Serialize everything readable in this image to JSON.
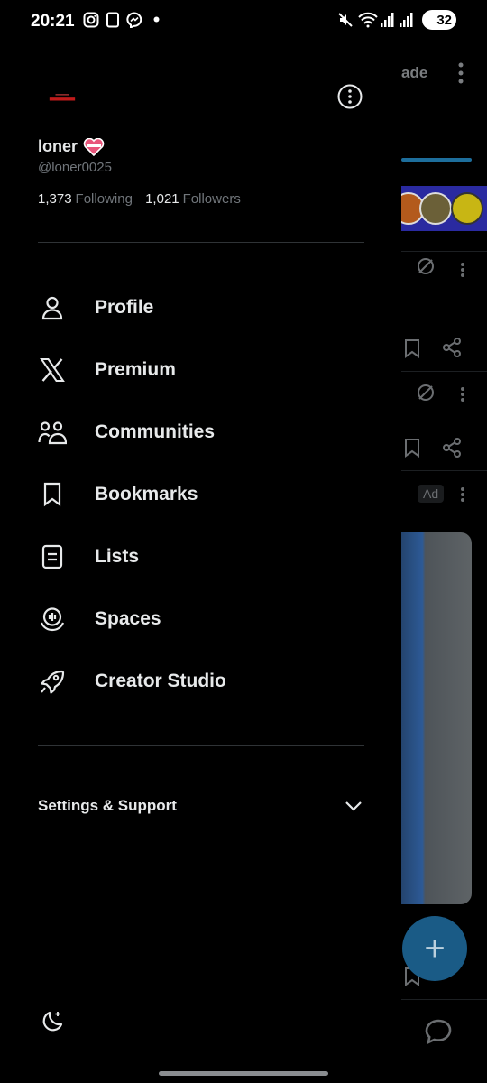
{
  "status_bar": {
    "time": "20:21",
    "battery": "32",
    "icons": [
      "instagram-icon",
      "tablet-icon",
      "messenger-icon",
      "dot-icon",
      "mute-icon",
      "wifi-icon",
      "signal-icon",
      "signal-icon",
      "battery-icon"
    ]
  },
  "background": {
    "header_partial": "ade",
    "ad_badge": "Ad"
  },
  "profile": {
    "name": "loner",
    "handle": "@loner0025",
    "following_count": "1,373",
    "following_label": "Following",
    "followers_count": "1,021",
    "followers_label": "Followers"
  },
  "menu": [
    {
      "label": "Profile",
      "icon": "person-icon"
    },
    {
      "label": "Premium",
      "icon": "x-logo-icon"
    },
    {
      "label": "Communities",
      "icon": "communities-icon"
    },
    {
      "label": "Bookmarks",
      "icon": "bookmark-icon"
    },
    {
      "label": "Lists",
      "icon": "list-icon"
    },
    {
      "label": "Spaces",
      "icon": "spaces-icon"
    },
    {
      "label": "Creator Studio",
      "icon": "rocket-icon"
    }
  ],
  "settings": {
    "label": "Settings & Support"
  },
  "colors": {
    "background": "#000000",
    "text_primary": "#e7e9ea",
    "text_secondary": "#71767b",
    "divider": "#2f3336",
    "fab": "#1a5b86"
  }
}
